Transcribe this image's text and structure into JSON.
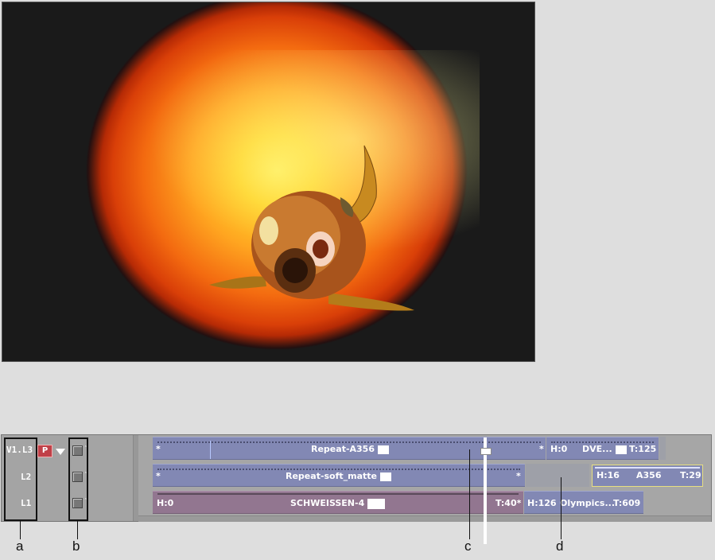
{
  "tracks": [
    {
      "name": "V1.L3",
      "patch_label": "P"
    },
    {
      "name": "L2"
    },
    {
      "name": "L1"
    }
  ],
  "lane_v1l3": {
    "seg1_star_left": "*",
    "seg1_name": "Repeat-A356",
    "seg1_star_right": "*",
    "seg2_head": "H:0",
    "seg2_name": "DVE...",
    "seg2_tail": "T:125"
  },
  "lane_l2": {
    "seg1_star_left": "*",
    "seg1_name": "Repeat-soft_matte",
    "seg1_star_right": "*",
    "seg3_head": "H:16",
    "seg3_name": "A356",
    "seg3_tail": "T:29"
  },
  "lane_l1": {
    "seg1_head": "H:0",
    "seg1_name": "SCHWEISSEN-4",
    "seg1_tail": "T:40*",
    "seg2_head": "H:126",
    "seg2_name": "Olympics...",
    "seg2_tail": "T:609"
  },
  "callouts": {
    "a": "a",
    "b": "b",
    "c": "c",
    "d": "d"
  },
  "colors": {
    "segment_blue": "#8288b4",
    "segment_mauve": "#927690",
    "selection_border": "#e8e080",
    "patch_red": "#c04048"
  }
}
